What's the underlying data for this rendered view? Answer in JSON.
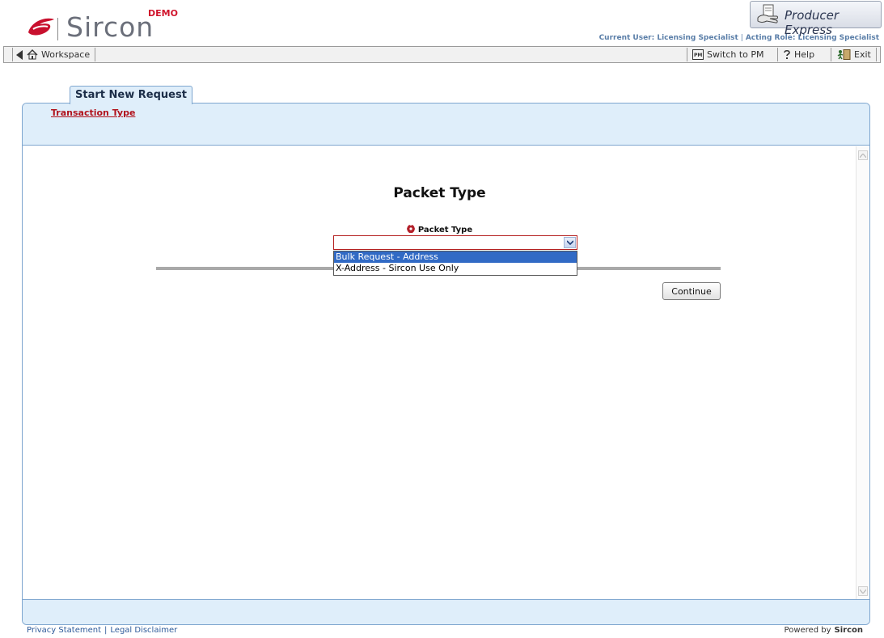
{
  "header": {
    "logo_text": "Sircon",
    "logo_badge": "DEMO",
    "product_name": "Producer Express",
    "current_user": "Current User: Licensing Specialist",
    "acting_role": "Acting Role: Licensing Specialist"
  },
  "toolbar": {
    "workspace_label": "Workspace",
    "switch_label": "Switch to PM",
    "help_label": "Help",
    "exit_label": "Exit"
  },
  "tab": {
    "label": "Start New Request"
  },
  "breadcrumb": {
    "label": "Transaction Type"
  },
  "main": {
    "heading": "Packet Type",
    "field_label": "Packet Type",
    "select_value": "",
    "options": [
      "Bulk Request - Address",
      "X-Address - Sircon Use Only"
    ],
    "highlighted_option": "Bulk Request - Address",
    "continue_label": "Continue"
  },
  "footer": {
    "privacy": "Privacy Statement",
    "legal": "Legal Disclaimer",
    "powered_by": "Powered by",
    "powered_brand": "Sircon"
  },
  "colors": {
    "accent_blue": "#dfeefa",
    "border_blue": "#7ea6cf",
    "link_red": "#b1121c",
    "selected_option": "#316ac5"
  }
}
